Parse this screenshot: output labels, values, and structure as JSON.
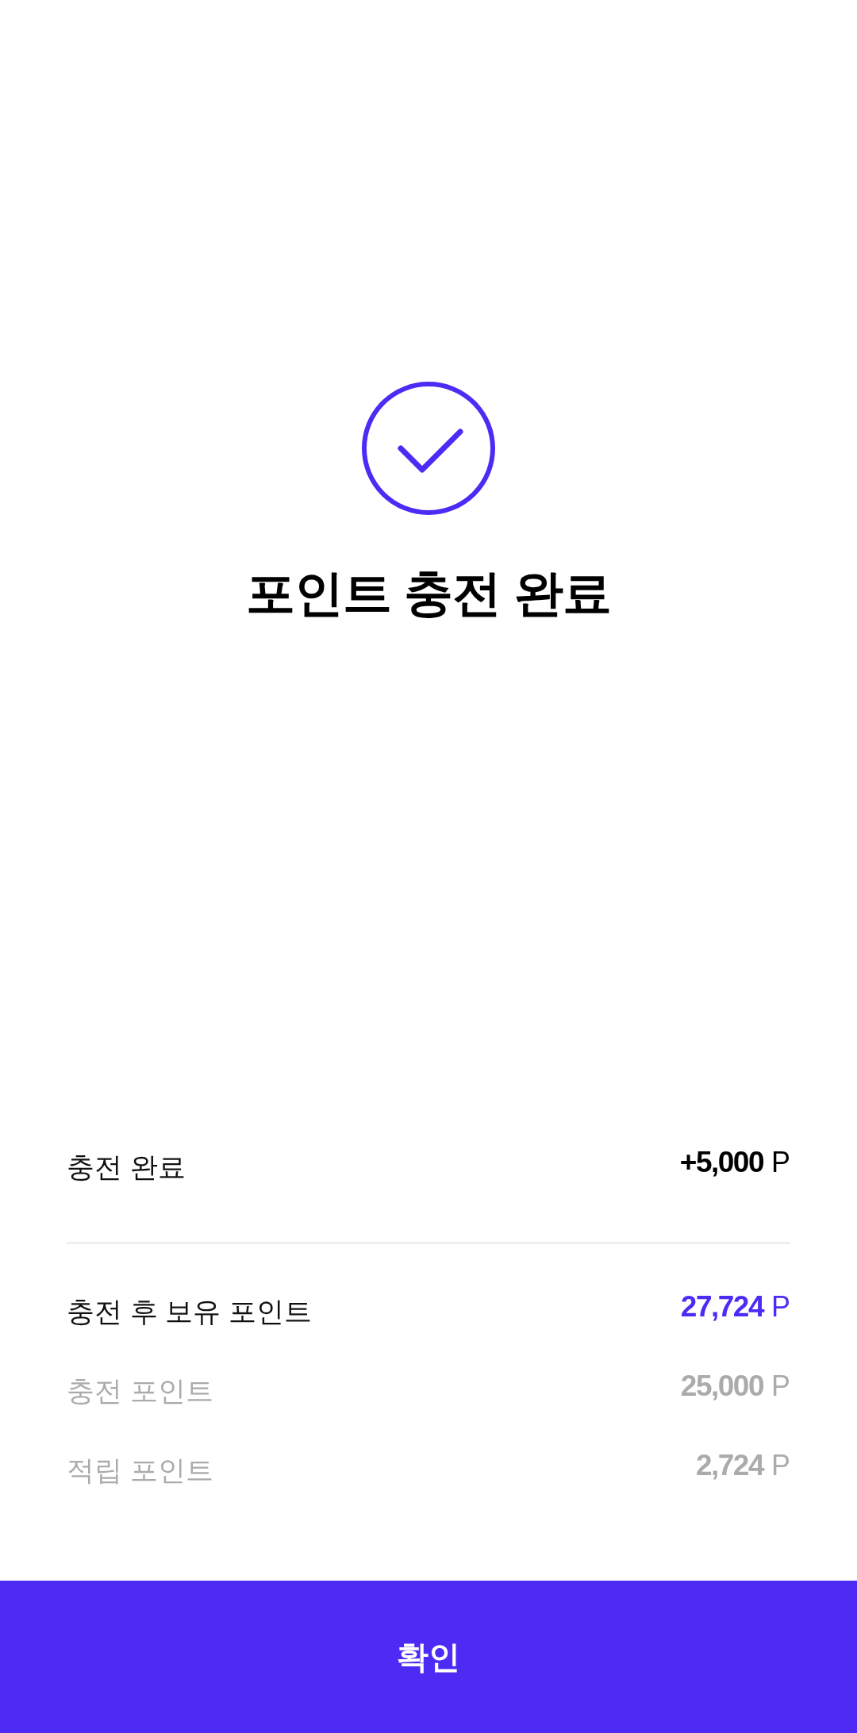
{
  "status": {
    "title": "포인트 충전 완료"
  },
  "summary": {
    "label": "충전 완료",
    "amount": "+5,000",
    "unit": "P"
  },
  "details": [
    {
      "kind": "total",
      "label": "충전 후 보유 포인트",
      "amount": "27,724",
      "unit": "P"
    },
    {
      "kind": "sub",
      "label": "충전 포인트",
      "amount": "25,000",
      "unit": "P"
    },
    {
      "kind": "sub",
      "label": "적립 포인트",
      "amount": "2,724",
      "unit": "P"
    }
  ],
  "confirm_button": {
    "label": "확인"
  }
}
